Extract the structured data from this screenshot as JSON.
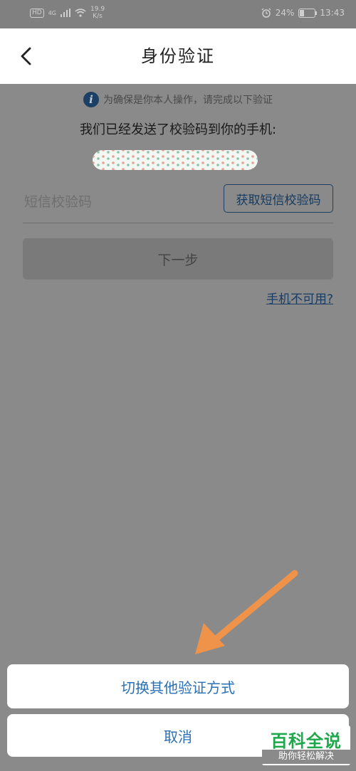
{
  "status_bar": {
    "hd": "HD",
    "network": "4G",
    "speed_value": "19.9",
    "speed_unit": "K/s",
    "battery_percent": "24%",
    "battery_level": 0.24,
    "time": "13:43",
    "icons": [
      "signal-icon",
      "wifi-icon",
      "alarm-icon",
      "battery-icon"
    ]
  },
  "header": {
    "title": "身份验证",
    "back_icon": "chevron-left-icon"
  },
  "info": {
    "icon_glyph": "i",
    "text": "为确保是你本人操作，请完成以下验证"
  },
  "sent_text": "我们已经发送了校验码到你的手机:",
  "form": {
    "code_placeholder": "短信校验码",
    "code_value": "",
    "get_code_label": "获取短信校验码",
    "next_label": "下一步",
    "phone_unavailable_label": "手机不可用?"
  },
  "action_sheet": {
    "switch_label": "切换其他验证方式",
    "cancel_label": "取消"
  },
  "watermark": {
    "title": "百科全说",
    "subtitle": "助你轻松解决"
  },
  "colors": {
    "overlay": "#8a8a8a",
    "accent": "#2a6fb5",
    "arrow": "#f0934a",
    "watermark_green": "#1ea84b"
  }
}
